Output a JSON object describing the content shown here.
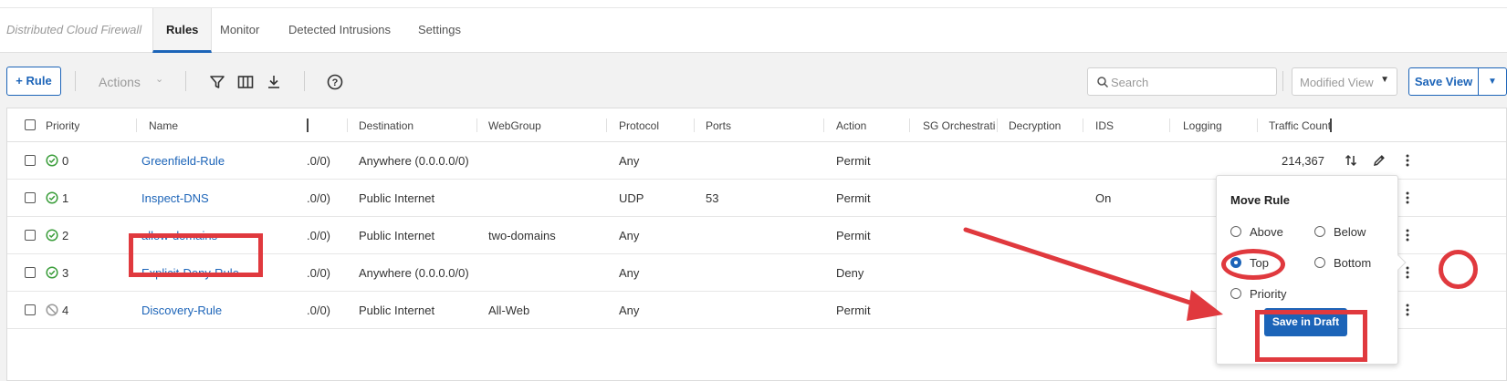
{
  "topnav": {
    "brand": "Distributed Cloud Firewall",
    "tabs": [
      {
        "label": "Rules"
      },
      {
        "label": "Monitor"
      },
      {
        "label": "Detected Intrusions"
      },
      {
        "label": "Settings"
      }
    ]
  },
  "toolbar": {
    "add_rule_label": "Rule",
    "add_rule_prefix": "+",
    "actions_label": "Actions",
    "icons": [
      "filter-icon",
      "columns-icon",
      "download-icon",
      "help-icon"
    ],
    "search_placeholder": "Search",
    "view_select": "Modified View",
    "save_view_label": "Save View"
  },
  "table": {
    "columns": [
      "Priority",
      "Name",
      "Destination",
      "WebGroup",
      "Protocol",
      "Ports",
      "Action",
      "SG Orchestration",
      "Decryption",
      "IDS",
      "Logging",
      "Traffic Count"
    ],
    "rows": [
      {
        "priority": "0",
        "status": "enabled",
        "name": "Greenfield-Rule",
        "source_tail": ".0/0)",
        "destination": "Anywhere (0.0.0.0/0)",
        "webgroup": "",
        "protocol": "Any",
        "ports": "",
        "action": "Permit",
        "ids": "",
        "traffic": "214,367"
      },
      {
        "priority": "1",
        "status": "enabled",
        "name": "Inspect-DNS",
        "source_tail": ".0/0)",
        "destination": "Public Internet",
        "webgroup": "",
        "protocol": "UDP",
        "ports": "53",
        "action": "Permit",
        "ids": "On",
        "traffic": ""
      },
      {
        "priority": "2",
        "status": "enabled",
        "name": "allow-domains",
        "source_tail": ".0/0)",
        "destination": "Public Internet",
        "webgroup": "two-domains",
        "protocol": "Any",
        "ports": "",
        "action": "Permit",
        "ids": "",
        "traffic": ""
      },
      {
        "priority": "3",
        "status": "enabled",
        "name": "Explicit-Deny-Rule",
        "source_tail": ".0/0)",
        "destination": "Anywhere (0.0.0.0/0)",
        "webgroup": "",
        "protocol": "Any",
        "ports": "",
        "action": "Deny",
        "ids": "",
        "traffic": ""
      },
      {
        "priority": "4",
        "status": "disabled",
        "name": "Discovery-Rule",
        "source_tail": ".0/0)",
        "destination": "Public Internet",
        "webgroup": "All-Web",
        "protocol": "Any",
        "ports": "",
        "action": "Permit",
        "ids": "",
        "traffic": ""
      }
    ]
  },
  "move_popover": {
    "title": "Move Rule",
    "options": [
      {
        "label": "Above",
        "selected": false
      },
      {
        "label": "Below",
        "selected": false
      },
      {
        "label": "Top",
        "selected": true
      },
      {
        "label": "Bottom",
        "selected": false
      },
      {
        "label": "Priority",
        "selected": false
      }
    ],
    "save_label": "Save in Draft"
  },
  "colors": {
    "accent": "#1c64b8",
    "annotation": "#e0393e",
    "status_ok": "#3a9d3a"
  }
}
